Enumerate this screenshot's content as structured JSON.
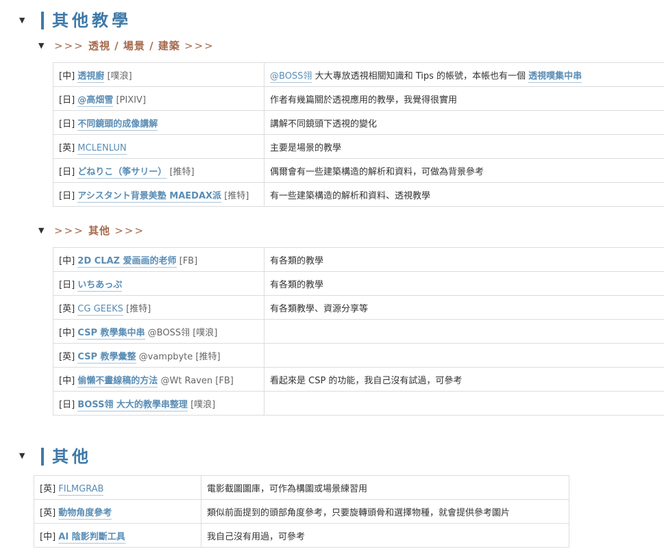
{
  "section1": {
    "title": "其他教學",
    "sub1": {
      "arrow": ">>>",
      "title": "透視 / 場景 / 建築",
      "rows": [
        {
          "lang": "[中]",
          "link": "透視廚",
          "extra": " [噗浪]",
          "desc_link": "@BOSS翎",
          "desc": " 大大專放透視相關知識和 Tips 的帳號，本帳也有一個 ",
          "desc_link2": "透視噗集中串"
        },
        {
          "lang": "[日]",
          "link": "@高畑雪",
          "extra": " [PIXIV]",
          "desc": "作者有幾篇關於透視應用的教學，我覺得很實用"
        },
        {
          "lang": "[日]",
          "link": "不同鏡頭的成像講解",
          "extra": "",
          "desc": "講解不同鏡頭下透視的變化"
        },
        {
          "lang": "[英]",
          "link": "MCLENLUN",
          "extra": "",
          "desc": "主要是場景的教學"
        },
        {
          "lang": "[日]",
          "link": "どねりこ（筝サリー）",
          "extra": " [推特]",
          "desc": "偶爾會有一些建築構造的解析和資料，可做為背景參考"
        },
        {
          "lang": "[日]",
          "link": "アシスタント背景美塾 MAEDAX派",
          "extra": " [推特]",
          "desc": "有一些建築構造的解析和資料、透視教學"
        }
      ]
    },
    "sub2": {
      "arrow": ">>>",
      "title": "其他",
      "rows": [
        {
          "lang": "[中]",
          "link": "2D CLAZ 爱画画的老师",
          "extra": " [FB]",
          "desc": "有各類的教學"
        },
        {
          "lang": "[日]",
          "link": "いちあっぷ",
          "extra": "",
          "desc": "有各類的教學"
        },
        {
          "lang": "[英]",
          "link": "CG GEEKS",
          "extra": " [推特]",
          "desc": "有各類教學、資源分享等"
        },
        {
          "lang": "[中]",
          "link": "CSP 教學集中串",
          "extra": " @BOSS翎 [噗浪]",
          "desc": ""
        },
        {
          "lang": "[英]",
          "link": "CSP 教學彙整",
          "extra": " @vampbyte [推特]",
          "desc": ""
        },
        {
          "lang": "[中]",
          "link": "偷懶不畫線稿的方法",
          "extra": "  @Wt Raven [FB]",
          "desc": "看起來是 CSP 的功能，我自己沒有試過，可參考"
        },
        {
          "lang": "[日]",
          "link": "BOSS翎 大大的教學串整理",
          "extra": " [噗浪]",
          "desc": ""
        }
      ]
    }
  },
  "section2": {
    "title": "其他",
    "rows": [
      {
        "lang": "[英]",
        "link": "FILMGRAB",
        "desc": "電影截圖圖庫，可作為構圖或場景練習用"
      },
      {
        "lang": "[英]",
        "link": "動物角度參考",
        "desc": "類似前面提到的頭部角度參考，只要旋轉頭骨和選擇物種，就會提供參考圖片"
      },
      {
        "lang": "[中]",
        "link": "AI 陰影判斷工具",
        "desc": "我自己沒有用過，可參考"
      }
    ]
  },
  "toggle_icon": "▼",
  "colors": {
    "heading": "#3f79a8",
    "subheading": "#a66a4d",
    "link": "#5a8db5",
    "border": "#dcdcdc"
  }
}
